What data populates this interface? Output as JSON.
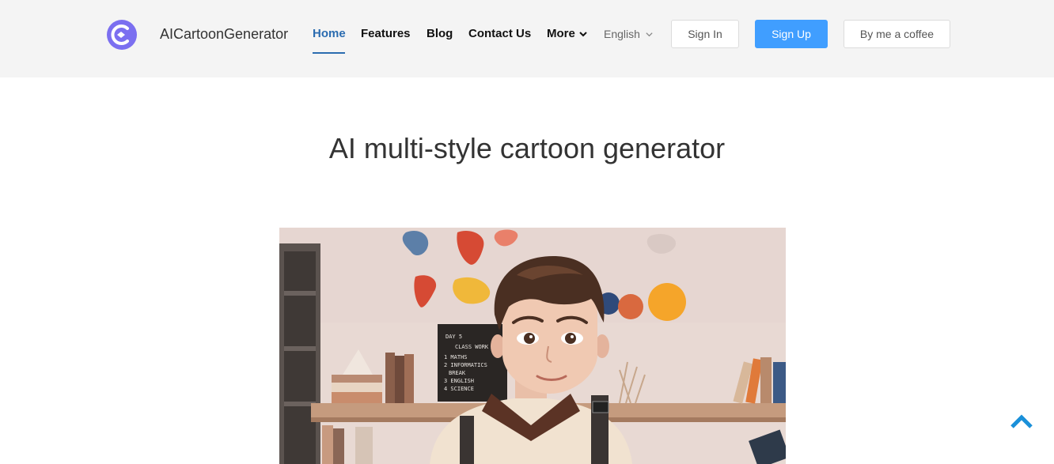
{
  "header": {
    "brand": "AICartoonGenerator",
    "nav": {
      "home": "Home",
      "features": "Features",
      "blog": "Blog",
      "contact": "Contact Us",
      "more": "More"
    },
    "language": "English",
    "sign_in": "Sign In",
    "sign_up": "Sign Up",
    "coffee": "By me a coffee"
  },
  "hero": {
    "title": "AI multi-style cartoon generator",
    "blackboard": [
      "DAY 5",
      "CLASS WORK",
      "1 MATHS",
      "2 INFORMATICS",
      "BREAK",
      "3 ENGLISH",
      "4 SCIENCE"
    ]
  },
  "colors": {
    "accent": "#409eff",
    "nav_active": "#2b6cb0",
    "logo": "#7b6ff0",
    "back_to_top": "#1a90d9"
  },
  "icons": {
    "logo": "logo-icon",
    "more": "chevron-down-icon",
    "language": "chevron-down-icon",
    "back_to_top": "arrow-up-icon"
  }
}
